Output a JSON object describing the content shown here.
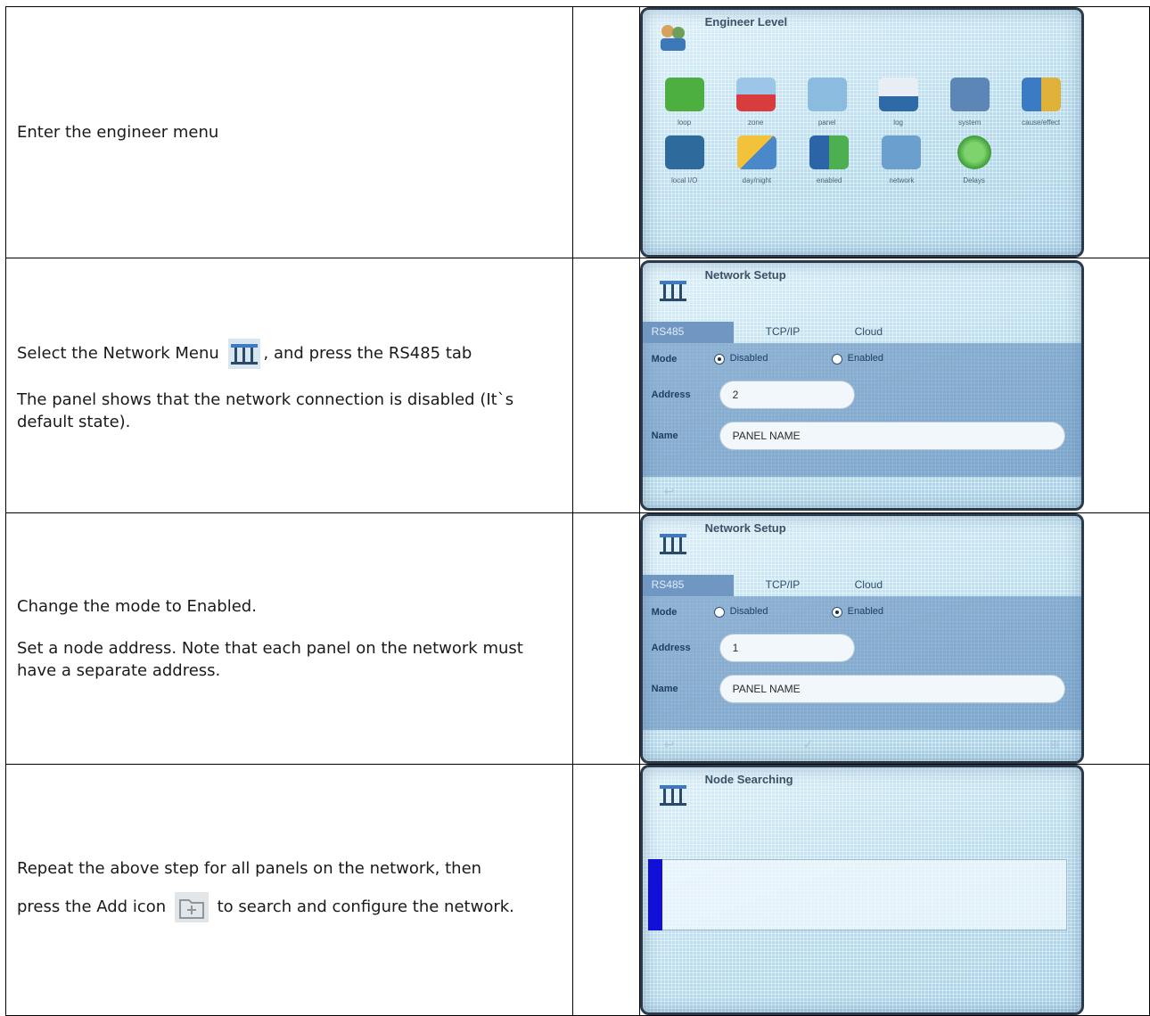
{
  "steps": [
    {
      "paragraphs": [
        {
          "text": "Enter the engineer menu"
        }
      ],
      "screen": {
        "type": "engineer",
        "title": "Engineer Level",
        "items": [
          {
            "label": "loop",
            "icon": "loop-icon"
          },
          {
            "label": "zone",
            "icon": "zone-icon"
          },
          {
            "label": "panel",
            "icon": "panel-icon"
          },
          {
            "label": "log",
            "icon": "log-icon"
          },
          {
            "label": "system",
            "icon": "system-icon"
          },
          {
            "label": "cause/effect",
            "icon": "cause-effect-icon"
          },
          {
            "label": "local I/O",
            "icon": "local-io-icon"
          },
          {
            "label": "day/night",
            "icon": "day-night-icon"
          },
          {
            "label": "enabled",
            "icon": "enabled-icon"
          },
          {
            "label": "network",
            "icon": "network-icon"
          },
          {
            "label": "Delays",
            "icon": "delays-icon"
          }
        ]
      }
    },
    {
      "paragraphs": [
        {
          "before_icon": "Select the Network Menu",
          "after_icon": ", and press the RS485 tab",
          "icon": "network-icon"
        },
        {
          "text": "The panel shows that the network connection is disabled (It`s default state)."
        }
      ],
      "screen": {
        "type": "network",
        "title": "Network Setup",
        "tabs": [
          "RS485",
          "TCP/IP",
          "Cloud"
        ],
        "mode_label": "Mode",
        "options": [
          "Disabled",
          "Enabled"
        ],
        "selected": "Disabled",
        "address_label": "Address",
        "address": "2",
        "name_label": "Name",
        "name": "PANEL NAME"
      }
    },
    {
      "paragraphs": [
        {
          "text": "Change the mode to Enabled."
        },
        {
          "text": "Set a node address. Note that each panel on the network must have a separate address."
        }
      ],
      "screen": {
        "type": "network",
        "title": "Network Setup",
        "tabs": [
          "RS485",
          "TCP/IP",
          "Cloud"
        ],
        "mode_label": "Mode",
        "options": [
          "Disabled",
          "Enabled"
        ],
        "selected": "Enabled",
        "address_label": "Address",
        "address": "1",
        "name_label": "Name",
        "name": "PANEL NAME"
      }
    },
    {
      "paragraphs": [
        {
          "text": "Repeat the above step for all panels on the network, then"
        },
        {
          "before_icon": "press the Add icon",
          "after_icon": "to search and configure the network.",
          "icon": "add-folder-icon"
        }
      ],
      "screen": {
        "type": "search",
        "title": "Node Searching"
      }
    }
  ],
  "colors": {
    "screen_bg": "#cfe6f2",
    "tab_active": "#6f97c1",
    "progress": "#1010d8"
  }
}
